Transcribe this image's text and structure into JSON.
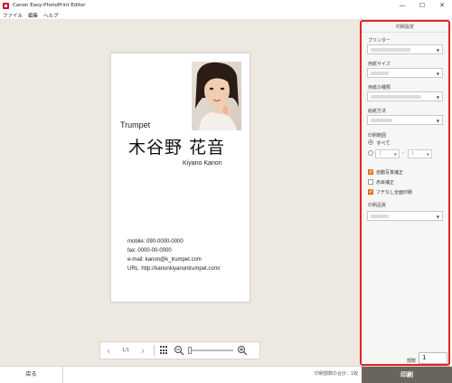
{
  "window": {
    "title": "Canon Easy-PhotoPrint Editor",
    "minimize": "—",
    "maximize": "☐",
    "close": "✕"
  },
  "menu": [
    "ファイル",
    "編集",
    "ヘルプ"
  ],
  "card": {
    "brand": "Trumpet",
    "name_jp": "木谷野 花音",
    "name_en": "Kiyano Kanon",
    "contact": [
      "mobile: 090-0000-0000",
      "fax: 0000-00-0000",
      "e-mail: kanon@k_trumpet.com",
      "URL: http://kanonkiyanontrumpet.com/"
    ]
  },
  "preview_nav": {
    "prev": "‹",
    "page": "1/1",
    "next": "›"
  },
  "panel": {
    "header": "印刷設定",
    "printer_label": "プリンター",
    "paper_size_label": "用紙サイズ",
    "media_type_label": "用紙の種類",
    "paper_source_label": "給紙方法",
    "print_range_label": "印刷範囲",
    "range_all": "すべて",
    "range_from": "1",
    "range_to": "1",
    "range_dash": "-",
    "options": [
      {
        "label": "自動写真補正",
        "checked": true
      },
      {
        "label": "赤目補正",
        "checked": false
      },
      {
        "label": "フチなし全面印刷",
        "checked": true
      }
    ],
    "quality_label": "印刷品質",
    "copies_label": "部数",
    "copies_value": "1"
  },
  "bottom": {
    "back": "戻る",
    "total": "印刷部数の合計：1枚",
    "print": "印刷"
  },
  "colors": {
    "accent": "#e0271f",
    "checkbox_on": "#f0862f",
    "print_button": "#6a655c",
    "preview_bg": "#ede9e1"
  }
}
